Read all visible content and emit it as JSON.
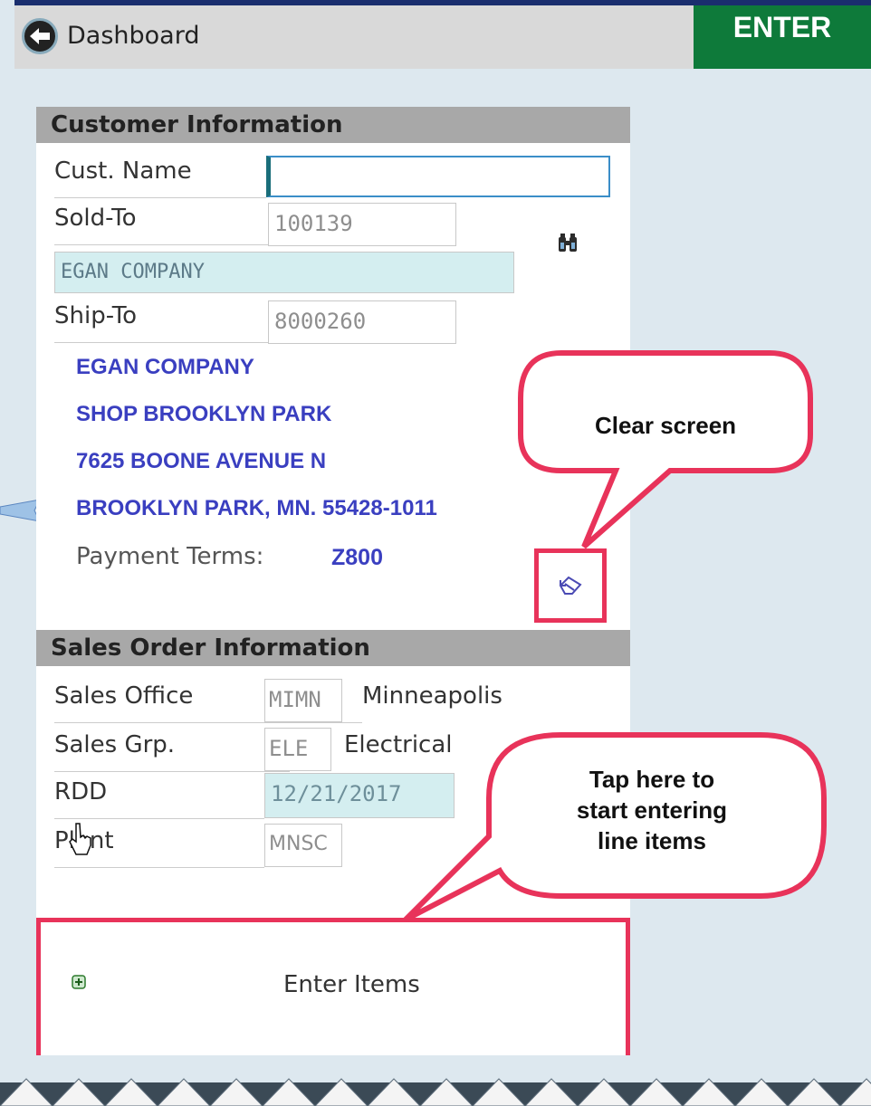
{
  "header": {
    "back_label": "Dashboard",
    "enter_label": "ENTER"
  },
  "customer": {
    "section_title": "Customer Information",
    "cust_name_label": "Cust. Name",
    "cust_name_value": "",
    "sold_to_label": "Sold-To",
    "sold_to_value": "100139",
    "sold_to_name": "EGAN COMPANY",
    "ship_to_label": "Ship-To",
    "ship_to_value": "8000260",
    "address": [
      "EGAN COMPANY",
      "SHOP BROOKLYN PARK",
      "7625 BOONE AVENUE N",
      "BROOKLYN PARK, MN. 55428-1011"
    ],
    "payment_terms_label": "Payment Terms:",
    "payment_terms_value": "Z800"
  },
  "sales_order": {
    "section_title": "Sales Order Information",
    "sales_office_label": "Sales Office",
    "sales_office_code": "MIMN",
    "sales_office_name": "Minneapolis",
    "sales_grp_label": "Sales Grp.",
    "sales_grp_code": "ELE",
    "sales_grp_name": "Electrical",
    "rdd_label": "RDD",
    "rdd_value": "12/21/2017",
    "plant_label": "Plant",
    "plant_value": "MNSC"
  },
  "enter_items_label": "Enter Items",
  "callouts": {
    "clear": "Clear screen",
    "tap_l1": "Tap here to",
    "tap_l2": "start entering",
    "tap_l3": "line items"
  },
  "colors": {
    "accent_green": "#0e7a3a",
    "address_blue": "#3a3fc0",
    "highlight_red": "#e8335a"
  }
}
